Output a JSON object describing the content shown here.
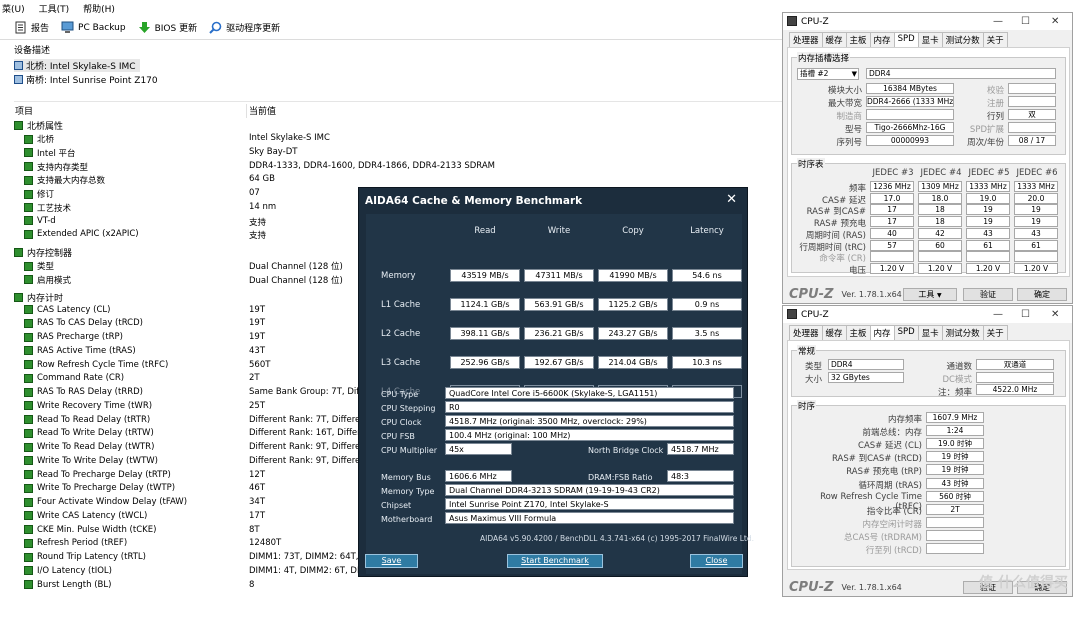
{
  "menu": [
    "菜(U)",
    "工具(T)",
    "帮助(H)"
  ],
  "toolbar": {
    "report": "报告",
    "pcbackup": "PC Backup",
    "bios": "BIOS 更新",
    "driver": "驱动程序更新"
  },
  "device_section": "设备描述",
  "devices": [
    "北桥: Intel Skylake-S IMC",
    "南桥: Intel Sunrise Point Z170"
  ],
  "columns": {
    "item": "项目",
    "value": "当前值"
  },
  "groups": {
    "nb": "北桥属性",
    "mc": "内存控制器",
    "mt": "内存计时"
  },
  "nb_rows": [
    [
      "北桥",
      "Intel Skylake-S IMC"
    ],
    [
      "Intel 平台",
      "Sky Bay-DT"
    ],
    [
      "支持内存类型",
      "DDR4-1333, DDR4-1600, DDR4-1866, DDR4-2133 SDRAM"
    ],
    [
      "支持最大内存总数",
      "64 GB"
    ],
    [
      "修订",
      "07"
    ],
    [
      "工艺技术",
      "14 nm"
    ],
    [
      "VT-d",
      "支持"
    ],
    [
      "Extended APIC (x2APIC)",
      "支持"
    ]
  ],
  "mc_rows": [
    [
      "类型",
      "Dual Channel  (128 位)"
    ],
    [
      "启用模式",
      "Dual Channel  (128 位)"
    ]
  ],
  "mt_rows": [
    [
      "CAS Latency (CL)",
      "19T"
    ],
    [
      "RAS To CAS Delay (tRCD)",
      "19T"
    ],
    [
      "RAS Precharge (tRP)",
      "19T"
    ],
    [
      "RAS Active Time (tRAS)",
      "43T"
    ],
    [
      "Row Refresh Cycle Time (tRFC)",
      "560T"
    ],
    [
      "Command Rate (CR)",
      "2T"
    ],
    [
      "RAS To RAS Delay (tRRD)",
      "Same Bank Group: 7T, Diff. B"
    ],
    [
      "Write Recovery Time (tWR)",
      "25T"
    ],
    [
      "Read To Read Delay (tRTR)",
      "Different Rank: 7T, Different"
    ],
    [
      "Read To Write Delay (tRTW)",
      "Different Rank: 16T, Different"
    ],
    [
      "Write To Read Delay (tWTR)",
      "Different Rank: 9T, Different"
    ],
    [
      "Write To Write Delay (tWTW)",
      "Different Rank: 9T, Different"
    ],
    [
      "Read To Precharge Delay (tRTP)",
      "12T"
    ],
    [
      "Write To Precharge Delay (tWTP)",
      "46T"
    ],
    [
      "Four Activate Window Delay (tFAW)",
      "34T"
    ],
    [
      "Write CAS Latency (tWCL)",
      "17T"
    ],
    [
      "CKE Min. Pulse Width (tCKE)",
      "8T"
    ],
    [
      "Refresh Period (tREF)",
      "12480T"
    ],
    [
      "Round Trip Latency (tRTL)",
      "DIMM1: 73T, DIMM2: 64T, DIMM3: 73T, DIMM4: 65T"
    ],
    [
      "I/O Latency (tIOL)",
      "DIMM1: 4T, DIMM2: 6T, DIMM3: 4T"
    ],
    [
      "Burst Length (BL)",
      "8"
    ]
  ],
  "bench": {
    "title": "AIDA64 Cache & Memory Benchmark",
    "close": "✕",
    "cols": [
      "Read",
      "Write",
      "Copy",
      "Latency"
    ],
    "rows": [
      {
        "label": "Memory",
        "vals": [
          "43519 MB/s",
          "47311 MB/s",
          "41990 MB/s",
          "54.6 ns"
        ]
      },
      {
        "label": "L1 Cache",
        "vals": [
          "1124.1 GB/s",
          "563.91 GB/s",
          "1125.2 GB/s",
          "0.9 ns"
        ]
      },
      {
        "label": "L2 Cache",
        "vals": [
          "398.11 GB/s",
          "236.21 GB/s",
          "243.27 GB/s",
          "3.5 ns"
        ]
      },
      {
        "label": "L3 Cache",
        "vals": [
          "252.96 GB/s",
          "192.67 GB/s",
          "214.04 GB/s",
          "10.3 ns"
        ]
      },
      {
        "label": "L4 Cache",
        "vals": [
          "",
          "",
          "",
          ""
        ]
      }
    ],
    "cpu_type_l": "CPU Type",
    "cpu_type": "QuadCore Intel Core i5-6600K  (Skylake-S, LGA1151)",
    "cpu_step_l": "CPU Stepping",
    "cpu_step": "R0",
    "cpu_clock_l": "CPU Clock",
    "cpu_clock": "4518.7 MHz  (original: 3500 MHz, overclock: 29%)",
    "cpu_fsb_l": "CPU FSB",
    "cpu_fsb": "100.4 MHz  (original: 100 MHz)",
    "cpu_mult_l": "CPU Multiplier",
    "cpu_mult": "45x",
    "nb_clock_l": "North Bridge Clock",
    "nb_clock": "4518.7 MHz",
    "mem_bus_l": "Memory Bus",
    "mem_bus": "1606.6 MHz",
    "ratio_l": "DRAM:FSB Ratio",
    "ratio": "48:3",
    "mem_type_l": "Memory Type",
    "mem_type": "Dual Channel DDR4-3213 SDRAM  (19-19-19-43 CR2)",
    "chipset_l": "Chipset",
    "chipset": "Intel Sunrise Point Z170, Intel Skylake-S",
    "mobo_l": "Motherboard",
    "mobo": "Asus Maximus VIII Formula",
    "footer": "AIDA64 v5.90.4200 / BenchDLL 4.3.741-x64  (c) 1995-2017 FinalWire Ltd.",
    "save": "Save",
    "start": "Start Benchmark",
    "close_btn": "Close"
  },
  "cpuz1": {
    "title": "CPU-Z",
    "tabs": [
      "处理器",
      "缓存",
      "主板",
      "内存",
      "SPD",
      "显卡",
      "测试分数",
      "关于"
    ],
    "slot_section": "内存插槽选择",
    "slot": "插槽 #2",
    "type": "DDR4",
    "labels": {
      "size": "模块大小",
      "bw": "最大带宽",
      "mfr": "制造商",
      "model": "型号",
      "serial": "序列号",
      "check": "校验",
      "reg": "注册",
      "rank": "行列",
      "spdext": "SPD扩展",
      "week": "周次/年份"
    },
    "size": "16384 MBytes",
    "bw": "DDR4-2666 (1333 MHz)",
    "mfr": "",
    "model": "Tigo-2666Mhz-16G",
    "serial": "00000993",
    "rank": "双",
    "week": "08 / 17",
    "timing_section": "时序表",
    "jedec": [
      "JEDEC #3",
      "JEDEC #4",
      "JEDEC #5",
      "JEDEC #6"
    ],
    "trows": [
      {
        "l": "频率",
        "v": [
          "1236 MHz",
          "1309 MHz",
          "1333 MHz",
          "1333 MHz"
        ]
      },
      {
        "l": "CAS# 延迟",
        "v": [
          "17.0",
          "18.0",
          "19.0",
          "20.0"
        ]
      },
      {
        "l": "RAS# 到CAS#",
        "v": [
          "17",
          "18",
          "19",
          "19"
        ]
      },
      {
        "l": "RAS# 预充电",
        "v": [
          "17",
          "18",
          "19",
          "19"
        ]
      },
      {
        "l": "周期时间 (RAS)",
        "v": [
          "40",
          "42",
          "43",
          "43"
        ]
      },
      {
        "l": "行周期时间 (tRC)",
        "v": [
          "57",
          "60",
          "61",
          "61"
        ]
      },
      {
        "l": "命令率 (CR)",
        "v": [
          "",
          "",
          "",
          ""
        ]
      },
      {
        "l": "电压",
        "v": [
          "1.20 V",
          "1.20 V",
          "1.20 V",
          "1.20 V"
        ]
      }
    ],
    "logo": "CPU-Z",
    "ver": "Ver. 1.78.1.x64",
    "tools": "工具",
    "validate": "验证",
    "ok": "确定"
  },
  "cpuz2": {
    "title": "CPU-Z",
    "tabs": [
      "处理器",
      "缓存",
      "主板",
      "内存",
      "SPD",
      "显卡",
      "测试分数",
      "关于"
    ],
    "gen_section": "常规",
    "labels": {
      "type": "类型",
      "size": "大小",
      "chan": "通道数",
      "dc": "DC模式",
      "nbf": "注：频率"
    },
    "type": "DDR4",
    "size": "32 GBytes",
    "chan": "双通道",
    "nbf": "4522.0 MHz",
    "tim_section": "时序",
    "trows": [
      {
        "l": "内存频率",
        "v": "1607.9 MHz"
      },
      {
        "l": "前端总线：内存",
        "v": "1:24"
      },
      {
        "l": "CAS# 延迟 (CL)",
        "v": "19.0 时钟"
      },
      {
        "l": "RAS# 到CAS# (tRCD)",
        "v": "19 时钟"
      },
      {
        "l": "RAS# 预充电 (tRP)",
        "v": "19 时钟"
      },
      {
        "l": "循环周期 (tRAS)",
        "v": "43 时钟"
      },
      {
        "l": "Row Refresh Cycle Time (tRFC)",
        "v": "560 时钟"
      },
      {
        "l": "指令比率 (CR)",
        "v": "2T"
      },
      {
        "l": "内存空闲计时器",
        "v": ""
      },
      {
        "l": "总CAS号 (tRDRAM)",
        "v": ""
      },
      {
        "l": "行至列 (tRCD)",
        "v": ""
      }
    ],
    "logo": "CPU-Z",
    "ver": "Ver. 1.78.1.x64",
    "validate": "验证",
    "ok": "确定"
  },
  "watermark": "值 什么值得买"
}
